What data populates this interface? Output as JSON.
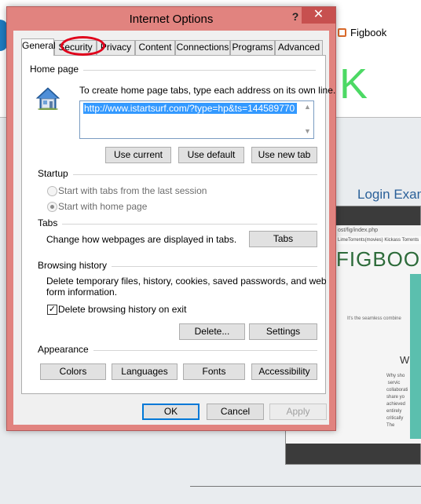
{
  "background": {
    "tab_title": "Figbook",
    "big_letter": "K",
    "login_text": "Login Exam",
    "page_address": "ost/fig/index.php",
    "page_bookmarks": "LimeTorrents(movies)  Kickass Torrents",
    "page_title": "FIGBOO",
    "page_tagline": "It's the seamless combine",
    "page_heading": "W",
    "page_body": "Why sho\n servic\ncollaborati\nshare yo\nachieved\nentirely\ncritically\nThe"
  },
  "dialog": {
    "title": "Internet Options",
    "help_glyph": "?",
    "close_glyph": "✕",
    "tabs": [
      {
        "label": "General",
        "active": true
      },
      {
        "label": "Security",
        "active": false,
        "highlighted": true
      },
      {
        "label": "Privacy",
        "active": false
      },
      {
        "label": "Content",
        "active": false
      },
      {
        "label": "Connections",
        "active": false
      },
      {
        "label": "Programs",
        "active": false
      },
      {
        "label": "Advanced",
        "active": false
      }
    ],
    "home_page": {
      "group_label": "Home page",
      "instruction": "To create home page tabs, type each address on its own line.",
      "url_value": "http://www.istartsurf.com/?type=hp&ts=144589770",
      "buttons": {
        "use_current": "Use current",
        "use_default": "Use default",
        "use_new_tab": "Use new tab"
      }
    },
    "startup": {
      "group_label": "Startup",
      "option_last_session": "Start with tabs from the last session",
      "option_home_page": "Start with home page",
      "selected": "option_home_page"
    },
    "tabs_section": {
      "group_label": "Tabs",
      "description": "Change how webpages are displayed in tabs.",
      "button": "Tabs"
    },
    "browsing_history": {
      "group_label": "Browsing history",
      "description_line1": "Delete temporary files, history, cookies, saved passwords, and web",
      "description_line2": "form information.",
      "checkbox_label": "Delete browsing history on exit",
      "checkbox_checked": true,
      "checkbox_mark": "✓",
      "delete_button": "Delete...",
      "settings_button": "Settings"
    },
    "appearance": {
      "group_label": "Appearance",
      "buttons": {
        "colors": "Colors",
        "languages": "Languages",
        "fonts": "Fonts",
        "accessibility": "Accessibility"
      }
    },
    "footer": {
      "ok": "OK",
      "cancel": "Cancel",
      "apply": "Apply"
    }
  },
  "colors": {
    "window_frame": "#e1837f",
    "close_button": "#c7504f",
    "highlight_circle": "#e0001b",
    "selection": "#3399ff"
  }
}
